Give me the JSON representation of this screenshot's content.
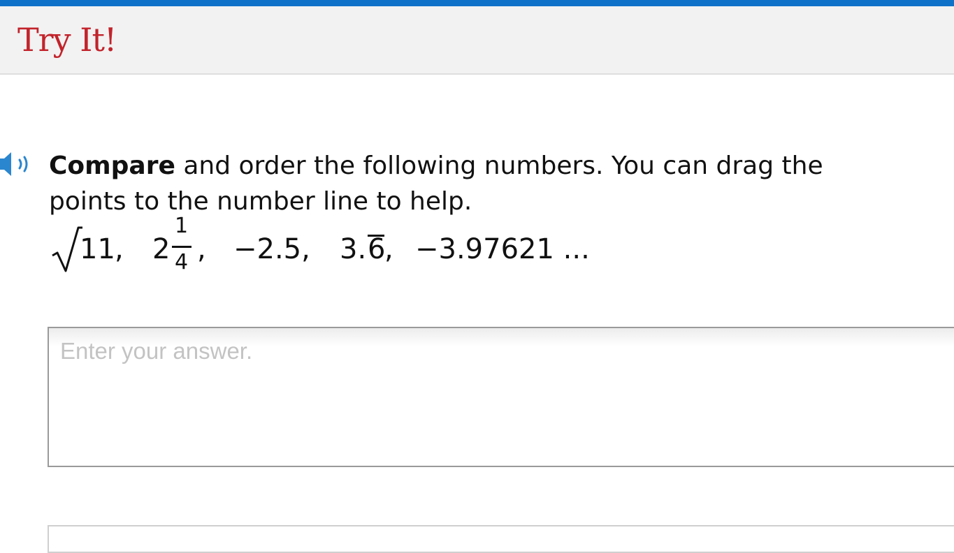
{
  "header": {
    "title": "Try It!",
    "accent_bar_color": "#1071c9",
    "title_color": "#c2232b"
  },
  "audio": {
    "icon": "speaker-icon"
  },
  "prompt": {
    "bold": "Compare",
    "rest_line1": " and order the following numbers. You can drag the",
    "line2": "points to the number line to help."
  },
  "numbers": {
    "sqrt_radicand": "11",
    "sep1": ",",
    "mixed_whole": "2",
    "frac_num": "1",
    "frac_den": "4",
    "sep2": ",",
    "neg_decimal": "−2.5,",
    "repeat_base": "3.",
    "repeat_digit": "6",
    "sep3": ",",
    "last_value": "−3.97621 ..."
  },
  "answer": {
    "placeholder": "Enter your answer."
  }
}
